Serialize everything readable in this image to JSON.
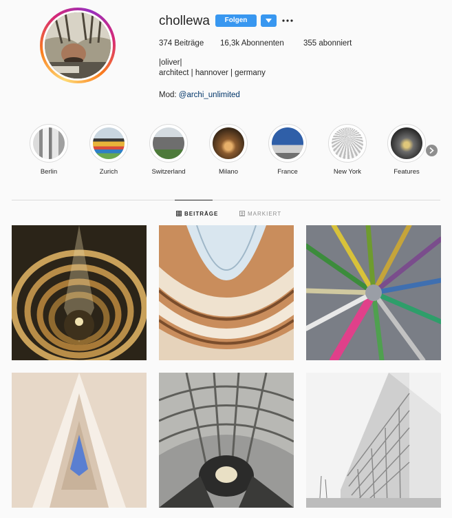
{
  "profile": {
    "username": "chollewa",
    "follow_label": "Folgen",
    "stats": {
      "posts": "374 Beiträge",
      "followers": "16,3k Abonnenten",
      "following": "355 abonniert"
    },
    "bio": {
      "name": "|oliver|",
      "line": "architect | hannover | germany",
      "mod_prefix": "Mod:",
      "mod_link": "@archi_unlimited"
    }
  },
  "highlights": [
    {
      "label": "Berlin"
    },
    {
      "label": "Zurich"
    },
    {
      "label": "Switzerland"
    },
    {
      "label": "Milano"
    },
    {
      "label": "France"
    },
    {
      "label": "New York"
    },
    {
      "label": "Features"
    }
  ],
  "tabs": {
    "posts": "BEITRÄGE",
    "tagged": "MARKIERT"
  },
  "colors": {
    "accent": "#3897f0",
    "link": "#003569",
    "text": "#262626",
    "muted": "#8e8e8e"
  }
}
